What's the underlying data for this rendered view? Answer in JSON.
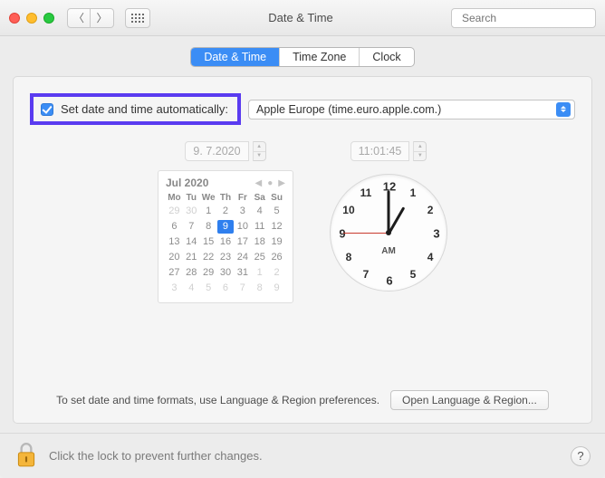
{
  "window": {
    "title": "Date & Time"
  },
  "search": {
    "placeholder": "Search"
  },
  "tabs": {
    "date_time": "Date & Time",
    "time_zone": "Time Zone",
    "clock": "Clock"
  },
  "auto": {
    "label": "Set date and time automatically:",
    "server": "Apple Europe (time.euro.apple.com.)"
  },
  "date_field": "9.  7.2020",
  "time_field": "11:01:45",
  "calendar": {
    "title": "Jul 2020",
    "dow": [
      "Mo",
      "Tu",
      "We",
      "Th",
      "Fr",
      "Sa",
      "Su"
    ],
    "leading": [
      29,
      30,
      1,
      2,
      3,
      4,
      5
    ],
    "weeks": [
      [
        6,
        7,
        8,
        9,
        10,
        11,
        12
      ],
      [
        13,
        14,
        15,
        16,
        17,
        18,
        19
      ],
      [
        20,
        21,
        22,
        23,
        24,
        25,
        26
      ],
      [
        27,
        28,
        29,
        30,
        31,
        1,
        2
      ]
    ],
    "trailing": [
      3,
      4,
      5,
      6,
      7,
      8,
      9
    ],
    "selected": 9
  },
  "clock": {
    "numbers": [
      "12",
      "1",
      "2",
      "3",
      "4",
      "5",
      "6",
      "7",
      "8",
      "9",
      "10",
      "11"
    ],
    "ampm": "AM"
  },
  "footer": {
    "hint": "To set date and time formats, use Language & Region preferences.",
    "button": "Open Language & Region..."
  },
  "lock": {
    "text": "Click the lock to prevent further changes."
  },
  "help": "?"
}
